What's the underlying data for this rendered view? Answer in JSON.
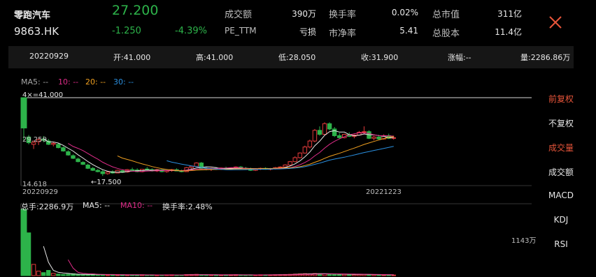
{
  "stock": {
    "name": "零跑汽车",
    "code": "9863.HK",
    "price": "27.200",
    "change": "-1.250",
    "change_pct": "-4.39%"
  },
  "stats": [
    {
      "label": "成交额",
      "value": "390万"
    },
    {
      "label": "PE_TTM",
      "value": "亏损"
    },
    {
      "label": "换手率",
      "value": "0.02%"
    },
    {
      "label": "市净率",
      "value": "5.41"
    },
    {
      "label": "总市值",
      "value": "311亿"
    },
    {
      "label": "总股本",
      "value": "11.4亿"
    }
  ],
  "ohlc": {
    "date": "20220929",
    "open_label": "开:",
    "open": "41.000",
    "high_label": "高:",
    "high": "41.000",
    "low_label": "低:",
    "low": "28.050",
    "close_label": "收:",
    "close": "31.900",
    "range_label": "涨幅:--",
    "volume_label": "量:2286.86万"
  },
  "price_legend": {
    "ma5": "MA5: --",
    "ma10": "10: --",
    "ma20": "20: --",
    "ma30": "30: --"
  },
  "price_axis": {
    "high_marker": "41.000",
    "mid": "29.250",
    "low": "14.618",
    "low_marker": "←17.500",
    "start_date": "20220929",
    "end_date": "20221223"
  },
  "volume_legend": {
    "total": "总手:2286.9万",
    "ma5": "MA5: --",
    "ma10": "MA10: --",
    "turnover": "换手率:2.48%"
  },
  "volume_axis": {
    "max": "1143万"
  },
  "menu": [
    {
      "label": "前复权",
      "active": true
    },
    {
      "label": "不复权",
      "active": false
    },
    {
      "label": "成交量",
      "active": true
    },
    {
      "label": "成交额",
      "active": false
    },
    {
      "label": "MACD",
      "active": false
    },
    {
      "label": "KDJ",
      "active": false
    },
    {
      "label": "RSI",
      "active": false
    }
  ],
  "colors": {
    "up": "#e43b3b",
    "down": "#2db34a",
    "ma5": "#e8e8e8",
    "ma10": "#e02c8a",
    "ma20": "#f0a020",
    "ma30": "#2a8fe0",
    "active_menu": "#e8553a"
  },
  "chart_data": {
    "type": "candlestick",
    "candles": [
      {
        "o": 41.0,
        "h": 41.0,
        "l": 28.05,
        "c": 31.9
      },
      {
        "o": 29.2,
        "h": 29.8,
        "l": 27.0,
        "c": 27.5
      },
      {
        "o": 27.0,
        "h": 28.2,
        "l": 25.6,
        "c": 27.6
      },
      {
        "o": 27.8,
        "h": 29.0,
        "l": 26.8,
        "c": 28.4
      },
      {
        "o": 28.6,
        "h": 29.5,
        "l": 27.6,
        "c": 28.2
      },
      {
        "o": 28.0,
        "h": 28.6,
        "l": 26.8,
        "c": 27.0
      },
      {
        "o": 27.0,
        "h": 27.6,
        "l": 26.4,
        "c": 27.3
      },
      {
        "o": 27.0,
        "h": 27.4,
        "l": 25.8,
        "c": 26.0
      },
      {
        "o": 26.0,
        "h": 26.4,
        "l": 24.8,
        "c": 25.0
      },
      {
        "o": 24.8,
        "h": 25.2,
        "l": 23.6,
        "c": 23.8
      },
      {
        "o": 23.6,
        "h": 24.0,
        "l": 22.6,
        "c": 22.8
      },
      {
        "o": 22.6,
        "h": 23.0,
        "l": 21.6,
        "c": 21.8
      },
      {
        "o": 21.6,
        "h": 21.9,
        "l": 20.8,
        "c": 21.0
      },
      {
        "o": 20.8,
        "h": 21.2,
        "l": 19.6,
        "c": 19.8
      },
      {
        "o": 19.8,
        "h": 20.2,
        "l": 19.0,
        "c": 19.2
      },
      {
        "o": 19.2,
        "h": 19.6,
        "l": 18.6,
        "c": 18.8
      },
      {
        "o": 18.8,
        "h": 19.3,
        "l": 17.5,
        "c": 18.2
      },
      {
        "o": 18.2,
        "h": 19.0,
        "l": 17.9,
        "c": 18.7
      },
      {
        "o": 18.8,
        "h": 19.2,
        "l": 18.2,
        "c": 18.4
      },
      {
        "o": 18.4,
        "h": 19.4,
        "l": 18.3,
        "c": 19.2
      },
      {
        "o": 19.1,
        "h": 19.5,
        "l": 18.4,
        "c": 18.6
      },
      {
        "o": 18.7,
        "h": 19.6,
        "l": 18.5,
        "c": 19.4
      },
      {
        "o": 19.4,
        "h": 20.0,
        "l": 19.0,
        "c": 19.3
      },
      {
        "o": 19.3,
        "h": 19.8,
        "l": 18.6,
        "c": 18.8
      },
      {
        "o": 18.8,
        "h": 19.6,
        "l": 18.6,
        "c": 19.5
      },
      {
        "o": 19.6,
        "h": 20.2,
        "l": 19.2,
        "c": 19.4
      },
      {
        "o": 19.4,
        "h": 19.8,
        "l": 18.8,
        "c": 19.0
      },
      {
        "o": 19.0,
        "h": 19.6,
        "l": 18.7,
        "c": 19.4
      },
      {
        "o": 19.3,
        "h": 19.5,
        "l": 18.6,
        "c": 18.8
      },
      {
        "o": 18.8,
        "h": 19.3,
        "l": 18.5,
        "c": 19.1
      },
      {
        "o": 19.1,
        "h": 19.6,
        "l": 18.8,
        "c": 19.4
      },
      {
        "o": 19.4,
        "h": 19.8,
        "l": 18.9,
        "c": 19.0
      },
      {
        "o": 19.0,
        "h": 19.4,
        "l": 18.6,
        "c": 18.8
      },
      {
        "o": 18.8,
        "h": 20.2,
        "l": 18.7,
        "c": 20.0
      },
      {
        "o": 20.0,
        "h": 20.6,
        "l": 19.6,
        "c": 20.4
      },
      {
        "o": 20.4,
        "h": 21.6,
        "l": 20.2,
        "c": 21.4
      },
      {
        "o": 21.4,
        "h": 21.7,
        "l": 19.6,
        "c": 19.8
      },
      {
        "o": 19.8,
        "h": 20.2,
        "l": 19.2,
        "c": 19.6
      },
      {
        "o": 19.6,
        "h": 20.0,
        "l": 19.0,
        "c": 19.8
      },
      {
        "o": 19.8,
        "h": 20.2,
        "l": 19.3,
        "c": 19.5
      },
      {
        "o": 19.5,
        "h": 20.1,
        "l": 19.3,
        "c": 19.9
      },
      {
        "o": 19.9,
        "h": 20.3,
        "l": 19.4,
        "c": 19.6
      },
      {
        "o": 19.6,
        "h": 20.0,
        "l": 19.3,
        "c": 19.9
      },
      {
        "o": 19.9,
        "h": 20.4,
        "l": 19.5,
        "c": 20.2
      },
      {
        "o": 20.2,
        "h": 20.5,
        "l": 19.6,
        "c": 19.8
      },
      {
        "o": 19.8,
        "h": 20.2,
        "l": 19.4,
        "c": 19.6
      },
      {
        "o": 19.6,
        "h": 20.0,
        "l": 19.0,
        "c": 19.2
      },
      {
        "o": 19.2,
        "h": 19.8,
        "l": 19.0,
        "c": 19.6
      },
      {
        "o": 19.6,
        "h": 20.0,
        "l": 19.3,
        "c": 19.8
      },
      {
        "o": 19.8,
        "h": 20.1,
        "l": 19.4,
        "c": 19.5
      },
      {
        "o": 19.5,
        "h": 19.9,
        "l": 19.2,
        "c": 19.7
      },
      {
        "o": 19.7,
        "h": 20.2,
        "l": 19.5,
        "c": 20.0
      },
      {
        "o": 20.0,
        "h": 20.4,
        "l": 19.7,
        "c": 20.2
      },
      {
        "o": 20.2,
        "h": 21.0,
        "l": 20.0,
        "c": 20.8
      },
      {
        "o": 20.8,
        "h": 22.0,
        "l": 20.6,
        "c": 21.8
      },
      {
        "o": 21.8,
        "h": 23.4,
        "l": 21.6,
        "c": 23.0
      },
      {
        "o": 23.0,
        "h": 24.6,
        "l": 22.8,
        "c": 24.4
      },
      {
        "o": 24.4,
        "h": 26.6,
        "l": 24.2,
        "c": 26.2
      },
      {
        "o": 26.2,
        "h": 28.4,
        "l": 25.8,
        "c": 28.0
      },
      {
        "o": 28.0,
        "h": 31.6,
        "l": 27.6,
        "c": 31.2
      },
      {
        "o": 31.2,
        "h": 32.4,
        "l": 29.6,
        "c": 30.0
      },
      {
        "o": 30.0,
        "h": 33.6,
        "l": 29.8,
        "c": 33.2
      },
      {
        "o": 33.2,
        "h": 33.6,
        "l": 31.2,
        "c": 31.6
      },
      {
        "o": 31.6,
        "h": 32.2,
        "l": 29.2,
        "c": 29.6
      },
      {
        "o": 29.6,
        "h": 30.4,
        "l": 28.6,
        "c": 29.0
      },
      {
        "o": 29.0,
        "h": 30.2,
        "l": 28.8,
        "c": 30.0
      },
      {
        "o": 30.0,
        "h": 30.6,
        "l": 29.2,
        "c": 29.4
      },
      {
        "o": 29.4,
        "h": 30.0,
        "l": 28.8,
        "c": 29.8
      },
      {
        "o": 29.8,
        "h": 31.0,
        "l": 29.6,
        "c": 30.6
      },
      {
        "o": 30.6,
        "h": 32.4,
        "l": 30.2,
        "c": 30.8
      },
      {
        "o": 30.8,
        "h": 31.2,
        "l": 28.6,
        "c": 28.8
      },
      {
        "o": 28.8,
        "h": 29.6,
        "l": 28.2,
        "c": 29.2
      },
      {
        "o": 29.2,
        "h": 29.8,
        "l": 28.4,
        "c": 28.6
      },
      {
        "o": 28.6,
        "h": 30.0,
        "l": 28.4,
        "c": 29.6
      },
      {
        "o": 29.6,
        "h": 30.2,
        "l": 28.6,
        "c": 28.8
      },
      {
        "o": 28.8,
        "h": 29.6,
        "l": 28.4,
        "c": 29.0
      }
    ],
    "volumes": [
      2286.9,
      1143,
      300,
      120,
      80,
      140,
      60,
      40,
      30,
      35,
      50,
      28,
      20,
      25,
      45,
      30,
      20,
      18,
      22,
      20,
      24,
      18,
      20,
      16,
      22,
      18,
      20,
      15,
      18,
      20,
      22,
      16,
      18,
      26,
      30,
      34,
      22,
      18,
      20,
      16,
      18,
      20,
      22,
      24,
      18,
      16,
      20,
      18,
      22,
      20,
      18,
      24,
      26,
      30,
      34,
      40,
      46,
      52,
      48,
      56,
      50,
      46,
      44,
      40,
      36,
      34,
      30,
      28,
      30,
      32,
      26,
      24,
      22,
      20,
      18,
      16
    ],
    "ylim": [
      14.618,
      41.0
    ]
  }
}
